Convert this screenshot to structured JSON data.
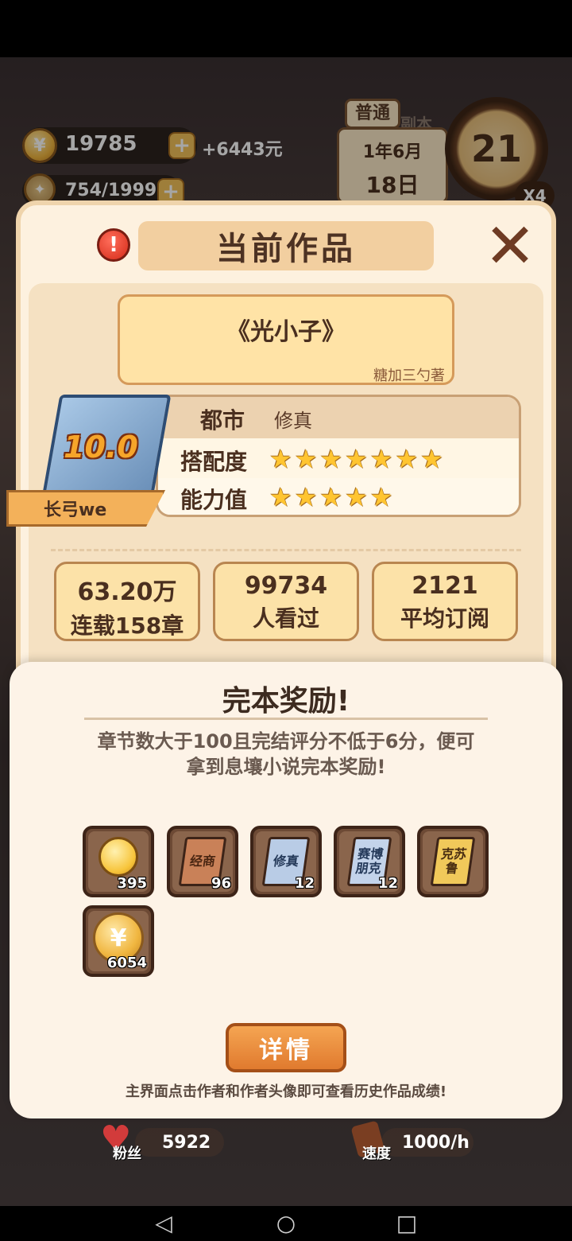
{
  "hud": {
    "coins": "19785",
    "coin_rate": "+6443元",
    "energy": "754/1999",
    "mode": "普通",
    "faded_tag": "副本",
    "date_line1": "1年6月",
    "date_line2": "18日",
    "day_counter": "21",
    "speed": "X4"
  },
  "panel": {
    "title": "当前作品",
    "book_title": "《光小子》",
    "author_line": "糖加三勺著",
    "book_score": "10.0",
    "writer_name": "长弓we",
    "genre_main": "都市",
    "genre_sub": "修真",
    "match_label": "搭配度",
    "match_stars": 7,
    "ability_label": "能力值",
    "ability_stars": 5,
    "stats": [
      {
        "value": "63.20万",
        "label": "连载158章"
      },
      {
        "value": "99734",
        "label": "人看过"
      },
      {
        "value": "2121",
        "label": "平均订阅"
      }
    ]
  },
  "reward": {
    "title": "完本奖励!",
    "desc_line1": "章节数大于100且完结评分不低于6分，便可",
    "desc_line2": "拿到息壤小说完本奖励!",
    "items": [
      {
        "name": "lightbulb",
        "label": "",
        "count": "395"
      },
      {
        "name": "book-jingshang",
        "label": "经商",
        "count": "96"
      },
      {
        "name": "book-xiuzhen",
        "label": "修真",
        "count": "12"
      },
      {
        "name": "book-saibo",
        "label": "赛博朋克",
        "count": "12"
      },
      {
        "name": "book-kesulu",
        "label": "克苏鲁",
        "count": ""
      },
      {
        "name": "coin",
        "label": "",
        "count": "6054"
      }
    ],
    "detail_button": "详情",
    "hint": "主界面点击作者和作者头像即可查看历史作品成绩!"
  },
  "bottom": {
    "fans_label": "粉丝",
    "fans_value": "5922",
    "speed_label": "速度",
    "speed_value": "1000/h"
  },
  "colors": {
    "panel_bg": "#fdf1df",
    "accent_orange": "#e07a2e",
    "star": "#ffc531",
    "stat_bg": "#fce2a8"
  }
}
